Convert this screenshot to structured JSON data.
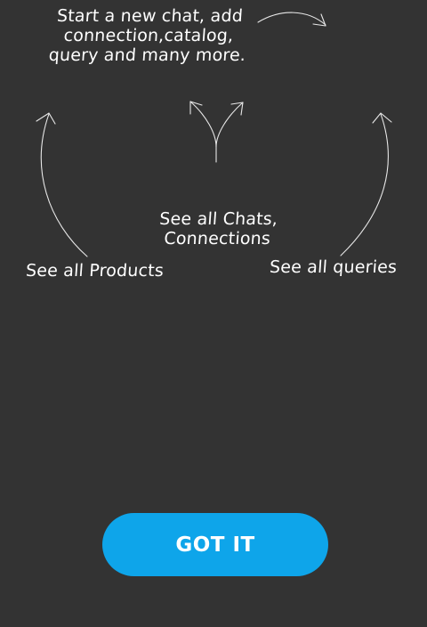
{
  "hints": {
    "new_chat": "Start a new chat, add\nconnection,catalog,\nquery and many more.",
    "chats": "See all Chats,\nConnections",
    "products": "See all Products",
    "queries": "See all queries"
  },
  "button": {
    "label": "GOT IT"
  },
  "colors": {
    "background": "#333333",
    "button": "#0ea5ea",
    "text": "#ffffff"
  }
}
